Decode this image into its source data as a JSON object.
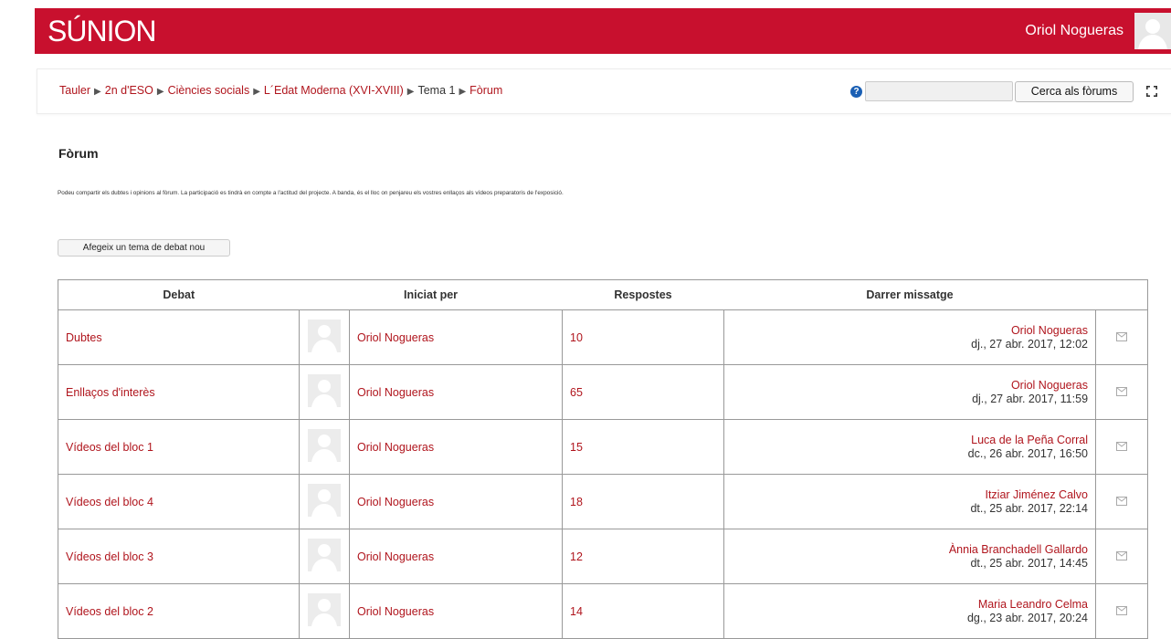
{
  "header": {
    "logo": "SÚNION",
    "user_name": "Oriol Nogueras"
  },
  "breadcrumb": [
    "Tauler",
    "2n d'ESO",
    "Ciències socials",
    "L´Edat Moderna (XVI-XVIII)",
    "Tema 1",
    "Fòrum"
  ],
  "search": {
    "value": "",
    "button_label": "Cerca als fòrums"
  },
  "page_title": "Fòrum",
  "intro": "Podeu compartir els dubtes i opinions al fòrum. La participació es tindrà en compte a l'actitud del projecte. A banda, és el lloc on penjareu els vostres enllaços als vídeos preparatoris de l'exposició.",
  "add_button_label": "Afegeix un tema de debat nou",
  "table": {
    "headers": {
      "debat": "Debat",
      "started_by": "Iniciat per",
      "replies": "Respostes",
      "last_post": "Darrer missatge"
    },
    "rows": [
      {
        "debat": "Dubtes",
        "started_by": "Oriol Nogueras",
        "replies": "10",
        "last_author": "Oriol Nogueras",
        "last_date": "dj., 27 abr. 2017, 12:02"
      },
      {
        "debat": "Enllaços d'interès",
        "started_by": "Oriol Nogueras",
        "replies": "65",
        "last_author": "Oriol Nogueras",
        "last_date": "dj., 27 abr. 2017, 11:59"
      },
      {
        "debat": "Vídeos del bloc 1",
        "started_by": "Oriol Nogueras",
        "replies": "15",
        "last_author": "Luca de la Peña Corral",
        "last_date": "dc., 26 abr. 2017, 16:50"
      },
      {
        "debat": "Vídeos del bloc 4",
        "started_by": "Oriol Nogueras",
        "replies": "18",
        "last_author": "Itziar Jiménez Calvo",
        "last_date": "dt., 25 abr. 2017, 22:14"
      },
      {
        "debat": "Vídeos del bloc 3",
        "started_by": "Oriol Nogueras",
        "replies": "12",
        "last_author": "Ànnia Branchadell Gallardo",
        "last_date": "dt., 25 abr. 2017, 14:45"
      },
      {
        "debat": "Vídeos del bloc 2",
        "started_by": "Oriol Nogueras",
        "replies": "14",
        "last_author": "Maria Leandro Celma",
        "last_date": "dg., 23 abr. 2017, 20:24"
      }
    ]
  },
  "colors": {
    "brand": "#c8102e",
    "link": "#b0151d"
  },
  "icons": {
    "help": "help-icon",
    "expand": "expand-icon",
    "user": "user-avatar-icon",
    "subscribe": "mail-icon"
  }
}
